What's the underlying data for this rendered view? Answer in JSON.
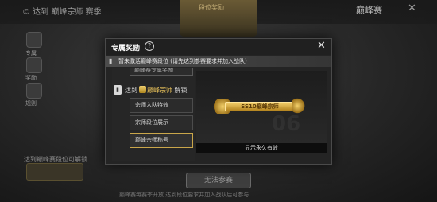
{
  "background": {
    "top_left_text": "© 达到 巅峰宗师 赛季",
    "banner_label": "段位奖励",
    "top_right_label": "巅峰赛",
    "side_items": [
      {
        "label": "专属"
      },
      {
        "label": "奖励"
      },
      {
        "label": "规则"
      }
    ],
    "bottom_left_text": "达到巅峰赛段位可解锁",
    "bottom_button_label": "无法参赛",
    "bottom_note": "巅峰赛每赛季开放 达到段位要求并加入战队后可参与"
  },
  "modal": {
    "title": "专属奖励",
    "notice": "暂未激活巅峰赛段位 (请先达到参赛要求并加入战队)",
    "cut_item_label": "巅峰赛专属奖励",
    "unlock": {
      "prefix": "达到",
      "rank_name": "巅峰宗师",
      "suffix": "解锁"
    },
    "reward_items": [
      {
        "label": "宗师入队特效"
      },
      {
        "label": "宗师段位展示"
      },
      {
        "label": "巅峰宗师称号"
      }
    ],
    "selected_index": 2,
    "preview": {
      "title_text": "SS10巅峰宗师",
      "duration": "显示永久有效"
    }
  },
  "colors": {
    "accent_gold": "#e9c25a",
    "modal_bg": "#242424"
  }
}
